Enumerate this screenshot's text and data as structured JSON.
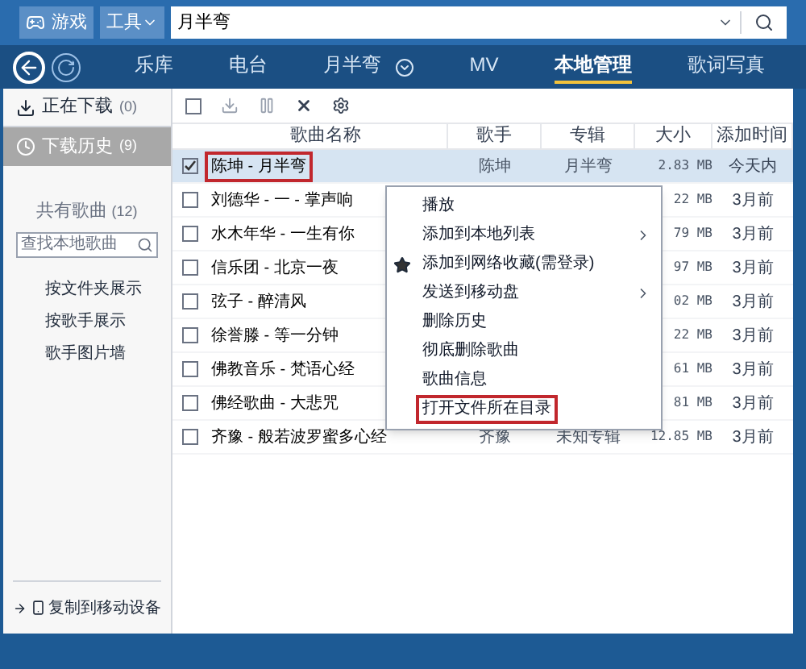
{
  "top_bar": {
    "game_button": "游戏",
    "tools_button": "工具",
    "search": {
      "value": "月半弯"
    }
  },
  "nav": {
    "tabs": [
      {
        "label": "乐库",
        "selected": false,
        "dropdown": false
      },
      {
        "label": "电台",
        "selected": false,
        "dropdown": false
      },
      {
        "label": "月半弯",
        "selected": false,
        "dropdown": true
      },
      {
        "label": "MV",
        "selected": false,
        "dropdown": false
      },
      {
        "label": "本地管理",
        "selected": true,
        "dropdown": false
      },
      {
        "label": "歌词写真",
        "selected": false,
        "dropdown": false
      }
    ]
  },
  "sidebar": {
    "downloads": [
      {
        "label": "正在下载",
        "count": "(0)",
        "selected": false,
        "kind": "downloading"
      },
      {
        "label": "下载历史",
        "count": "(9)",
        "selected": true,
        "kind": "history"
      }
    ],
    "total": {
      "label": "共有歌曲",
      "count": "(12)"
    },
    "search": {
      "placeholder": "查找本地歌曲"
    },
    "views": [
      "按文件夹展示",
      "按歌手展示",
      "歌手图片墙"
    ],
    "copy_button": "复制到移动设备"
  },
  "table": {
    "select_all": {
      "checked": false
    },
    "columns": [
      "歌曲名称",
      "歌手",
      "专辑",
      "大小",
      "添加时间"
    ],
    "rows": [
      {
        "name": "陈坤 - 月半弯",
        "artist": "陈坤",
        "album": "月半弯",
        "size": "2.83 MB",
        "time": "今天内",
        "checked": true,
        "selected": true,
        "annotated": true
      },
      {
        "name": "刘德华 - 一 - 掌声响",
        "size": "22 MB",
        "time": "3月前",
        "checked": false,
        "selected": false,
        "annotated": false
      },
      {
        "name": "水木年华 - 一生有你",
        "size": "79 MB",
        "time": "3月前",
        "checked": false,
        "selected": false,
        "annotated": false
      },
      {
        "name": "信乐团 - 北京一夜",
        "size": "97 MB",
        "time": "3月前",
        "checked": false,
        "selected": false,
        "annotated": false
      },
      {
        "name": "弦子 - 醉清风",
        "size": "02 MB",
        "time": "3月前",
        "checked": false,
        "selected": false,
        "annotated": false
      },
      {
        "name": "徐誉滕 - 等一分钟",
        "size": "22 MB",
        "time": "3月前",
        "checked": false,
        "selected": false,
        "annotated": false
      },
      {
        "name": "佛教音乐 - 梵语心经",
        "size": "61 MB",
        "time": "3月前",
        "checked": false,
        "selected": false,
        "annotated": false
      },
      {
        "name": "佛经歌曲 - 大悲咒",
        "size": "81 MB",
        "time": "3月前",
        "checked": false,
        "selected": false,
        "annotated": false
      },
      {
        "name": "齐豫 - 般若波罗蜜多心经",
        "artist": "齐豫",
        "album": "未知专辑",
        "size": "12.85 MB",
        "time": "3月前",
        "checked": false,
        "selected": false,
        "annotated": false
      }
    ]
  },
  "context_menu": [
    {
      "label": "播放",
      "kind": "plain",
      "annotated": false
    },
    {
      "label": "添加到本地列表",
      "kind": "submenu",
      "annotated": false
    },
    {
      "label": "添加到网络收藏(需登录)",
      "kind": "starred",
      "annotated": false
    },
    {
      "label": "发送到移动盘",
      "kind": "submenu",
      "annotated": false
    },
    {
      "label": "删除历史",
      "kind": "plain",
      "annotated": false
    },
    {
      "label": "彻底删除歌曲",
      "kind": "plain",
      "annotated": false
    },
    {
      "label": "歌曲信息",
      "kind": "plain",
      "annotated": false
    },
    {
      "label": "打开文件所在目录",
      "kind": "plain",
      "annotated": true
    }
  ]
}
